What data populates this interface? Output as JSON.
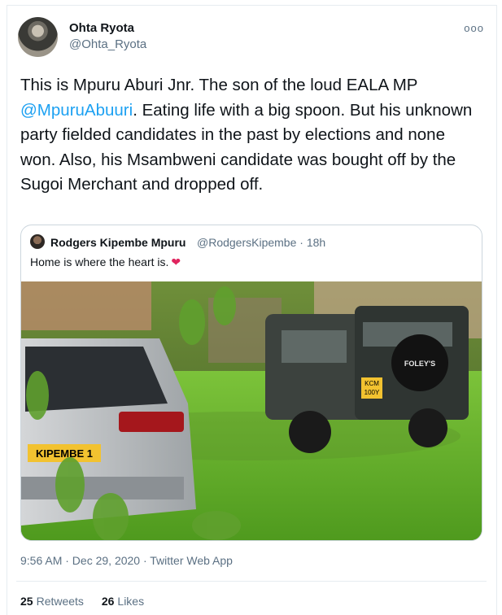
{
  "author": {
    "name": "Ohta Ryota",
    "handle": "@Ohta_Ryota"
  },
  "more_icon": "ooo",
  "tweet": {
    "text_before": "This is Mpuru Aburi Jnr. The son of the loud EALA MP ",
    "mention": "@MpuruAbuuri",
    "text_after": ". Eating life with a big spoon. But his unknown party fielded candidates in the past by elections and none won. Also, his Msambweni candidate was bought off by the Sugoi Merchant and dropped off."
  },
  "quote": {
    "name": "Rodgers Kipembe Mpuru",
    "handle_time": "@RodgersKipembe · 18h",
    "text": "Home is where the heart is.",
    "heart": "❤",
    "photo": {
      "plate_left": "KIPEMBE 1",
      "plate_right_line1": "KCM",
      "plate_right_line2": "100Y",
      "spare_cover": "FOLEY'S"
    }
  },
  "meta": "9:56 AM · Dec 29, 2020 · Twitter Web App",
  "stats": {
    "retweets_count": "25",
    "retweets_label": "Retweets",
    "likes_count": "26",
    "likes_label": "Likes"
  }
}
